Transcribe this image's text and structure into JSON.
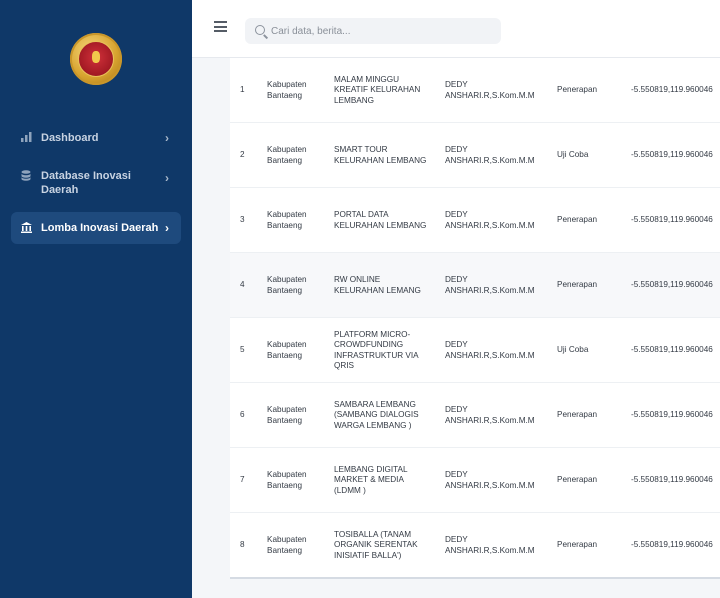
{
  "search": {
    "placeholder": "Cari data, berita..."
  },
  "sidebar": {
    "items": [
      {
        "icon": "bar-chart-icon",
        "label": "Dashboard"
      },
      {
        "icon": "database-icon",
        "label": "Database Inovasi Daerah"
      },
      {
        "icon": "bank-icon",
        "label": "Lomba Inovasi Daerah",
        "active": true
      }
    ]
  },
  "table": {
    "rows": [
      {
        "no": "1",
        "region": "Kabupaten Bantaeng",
        "name": "MALAM MINGGU KREATIF KELURAHAN LEMBANG",
        "author": "DEDY ANSHARI.R,S.Kom.M.M",
        "stage": "Penerapan",
        "coord": "-5.550819,119.960046"
      },
      {
        "no": "2",
        "region": "Kabupaten Bantaeng",
        "name": "SMART TOUR KELURAHAN LEMBANG",
        "author": "DEDY ANSHARI.R,S.Kom.M.M",
        "stage": "Uji Coba",
        "coord": "-5.550819,119.960046"
      },
      {
        "no": "3",
        "region": "Kabupaten Bantaeng",
        "name": "PORTAL DATA KELURAHAN LEMBANG",
        "author": "DEDY ANSHARI.R,S.Kom.M.M",
        "stage": "Penerapan",
        "coord": "-5.550819,119.960046"
      },
      {
        "no": "4",
        "region": "Kabupaten Bantaeng",
        "name": "RW ONLINE KELURAHAN LEMANG",
        "author": "DEDY ANSHARI.R,S.Kom.M.M",
        "stage": "Penerapan",
        "coord": "-5.550819,119.960046"
      },
      {
        "no": "5",
        "region": "Kabupaten Bantaeng",
        "name": "PLATFORM MICRO-CROWDFUNDING INFRASTRUKTUR VIA QRIS",
        "author": "DEDY ANSHARI.R,S.Kom.M.M",
        "stage": "Uji Coba",
        "coord": "-5.550819,119.960046"
      },
      {
        "no": "6",
        "region": "Kabupaten Bantaeng",
        "name": "SAMBARA LEMBANG (SAMBANG DIALOGIS WARGA LEMBANG )",
        "author": "DEDY ANSHARI.R,S.Kom.M.M",
        "stage": "Penerapan",
        "coord": "-5.550819,119.960046"
      },
      {
        "no": "7",
        "region": "Kabupaten Bantaeng",
        "name": "LEMBANG DIGITAL MARKET & MEDIA (LDMM )",
        "author": "DEDY ANSHARI.R,S.Kom.M.M",
        "stage": "Penerapan",
        "coord": "-5.550819,119.960046"
      },
      {
        "no": "8",
        "region": "Kabupaten Bantaeng",
        "name": "TOSIBALLA (TANAM ORGANIK SERENTAK INISIATIF BALLA')",
        "author": "DEDY ANSHARI.R,S.Kom.M.M",
        "stage": "Penerapan",
        "coord": "-5.550819,119.960046"
      }
    ]
  }
}
